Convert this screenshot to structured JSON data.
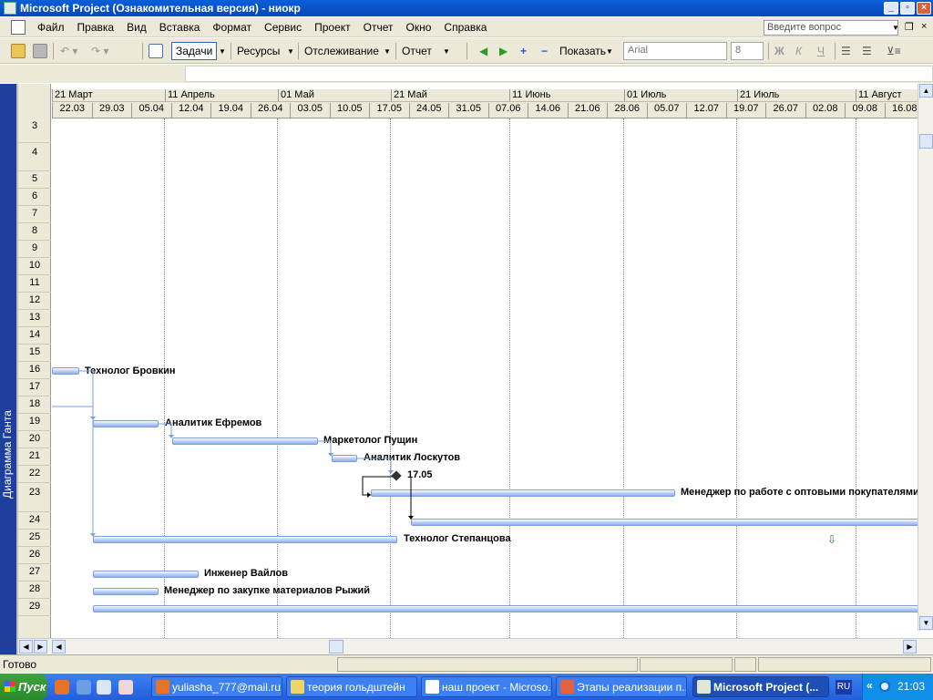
{
  "window": {
    "title": "Microsoft Project (Ознакомительная версия) - ниокр"
  },
  "menu": {
    "items": [
      "Файл",
      "Правка",
      "Вид",
      "Вставка",
      "Формат",
      "Сервис",
      "Проект",
      "Отчет",
      "Окно",
      "Справка"
    ],
    "question_placeholder": "Введите вопрос"
  },
  "toolbar": {
    "tasks": "Задачи",
    "resources": "Ресурсы",
    "tracking": "Отслеживание",
    "report": "Отчет",
    "show": "Показать",
    "font": "Arial",
    "font_size": "8",
    "bold": "Ж",
    "italic": "К",
    "underline": "Ч"
  },
  "viewbar": {
    "label": "Диаграмма Ганта"
  },
  "rows": [
    "3",
    "4",
    "5",
    "6",
    "7",
    "8",
    "9",
    "10",
    "11",
    "12",
    "13",
    "14",
    "15",
    "16",
    "17",
    "18",
    "19",
    "20",
    "21",
    "22",
    "23",
    "24",
    "25",
    "26",
    "27",
    "28",
    "29"
  ],
  "timescale": {
    "major": [
      "21 Март",
      "11 Апрель",
      "01 Май",
      "21 Май",
      "11 Июнь",
      "01 Июль",
      "21 Июль",
      "11 Август"
    ],
    "minor": [
      "22.03",
      "29.03",
      "05.04",
      "12.04",
      "19.04",
      "26.04",
      "03.05",
      "10.05",
      "17.05",
      "24.05",
      "31.05",
      "07.06",
      "14.06",
      "21.06",
      "28.06",
      "05.07",
      "12.07",
      "19.07",
      "26.07",
      "02.08",
      "09.08",
      "16.08"
    ]
  },
  "gantt": {
    "resources": [
      "Технолог Бровкин",
      "Аналитик Ефремов",
      "Маркетолог Пущин",
      "Аналитик Лоскутов",
      "Менеджер по работе с оптовыми покупателями",
      "Технолог Степанцова",
      "Инженер Вайлов",
      "Менеджер по закупке материалов Рыжий"
    ],
    "milestone_label": "17.05"
  },
  "status": {
    "text": "Готово"
  },
  "taskbar": {
    "start": "Пуск",
    "tasks": [
      "yuliasha_777@mail.ru...",
      "теория гольдштейн",
      "наш проект - Microso...",
      "Этапы реализации п...",
      "Microsoft Project (..."
    ],
    "lang": "RU",
    "clock": "21:03"
  }
}
